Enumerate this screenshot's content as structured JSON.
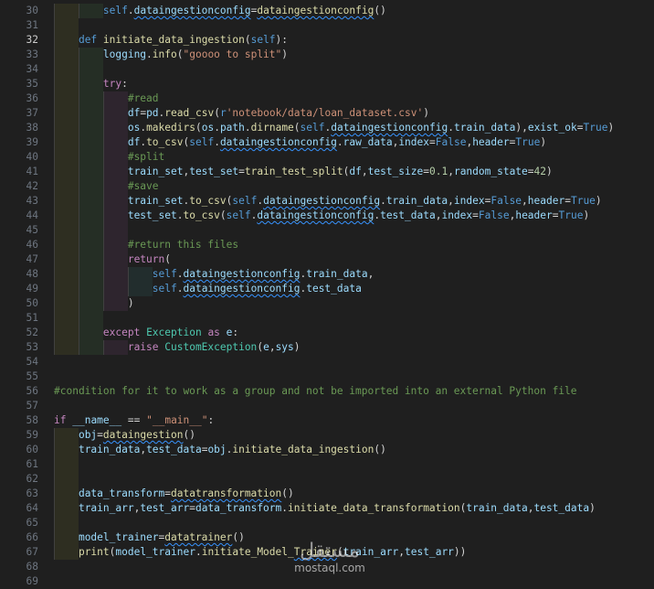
{
  "editor": {
    "lines": [
      {
        "n": "30",
        "text": "        self.dataingestionconfig=dataingestionconfig()"
      },
      {
        "n": "31",
        "text": ""
      },
      {
        "n": "32",
        "text": "    def initiate_data_ingestion(self):"
      },
      {
        "n": "33",
        "text": "        logging.info(\"goooo to split\")"
      },
      {
        "n": "34",
        "text": ""
      },
      {
        "n": "35",
        "text": "        try:"
      },
      {
        "n": "36",
        "text": "            #read"
      },
      {
        "n": "37",
        "text": "            df=pd.read_csv(r'notebook/data/loan_dataset.csv')"
      },
      {
        "n": "38",
        "text": "            os.makedirs(os.path.dirname(self.dataingestionconfig.train_data),exist_ok=True)"
      },
      {
        "n": "39",
        "text": "            df.to_csv(self.dataingestionconfig.raw_data,index=False,header=True)"
      },
      {
        "n": "40",
        "text": "            #split"
      },
      {
        "n": "41",
        "text": "            train_set,test_set=train_test_split(df,test_size=0.1,random_state=42)"
      },
      {
        "n": "42",
        "text": "            #save"
      },
      {
        "n": "43",
        "text": "            train_set.to_csv(self.dataingestionconfig.train_data,index=False,header=True)"
      },
      {
        "n": "44",
        "text": "            test_set.to_csv(self.dataingestionconfig.test_data,index=False,header=True)"
      },
      {
        "n": "45",
        "text": ""
      },
      {
        "n": "46",
        "text": "            #return this files"
      },
      {
        "n": "47",
        "text": "            return("
      },
      {
        "n": "48",
        "text": "                self.dataingestionconfig.train_data,"
      },
      {
        "n": "49",
        "text": "                self.dataingestionconfig.test_data"
      },
      {
        "n": "50",
        "text": "            )"
      },
      {
        "n": "51",
        "text": ""
      },
      {
        "n": "52",
        "text": "        except Exception as e:"
      },
      {
        "n": "53",
        "text": "            raise CustomException(e,sys)"
      },
      {
        "n": "54",
        "text": ""
      },
      {
        "n": "55",
        "text": ""
      },
      {
        "n": "56",
        "text": "#condition for it to work as a group and not be imported into an external Python file"
      },
      {
        "n": "57",
        "text": ""
      },
      {
        "n": "58",
        "text": "if __name__ == \"__main__\":"
      },
      {
        "n": "59",
        "text": "    obj=dataingestion()"
      },
      {
        "n": "60",
        "text": "    train_data,test_data=obj.initiate_data_ingestion()"
      },
      {
        "n": "61",
        "text": ""
      },
      {
        "n": "62",
        "text": ""
      },
      {
        "n": "63",
        "text": "    data_transform=datatransformation()"
      },
      {
        "n": "64",
        "text": "    train_arr,test_arr=data_transform.initiate_data_transformation(train_data,test_data)"
      },
      {
        "n": "65",
        "text": ""
      },
      {
        "n": "66",
        "text": "    model_trainer=datatrainer()"
      },
      {
        "n": "67",
        "text": "    print(model_trainer.initiate_Model_Trainer(train_arr,test_arr))"
      },
      {
        "n": "68",
        "text": ""
      },
      {
        "n": "69",
        "text": ""
      }
    ],
    "current_line": "32"
  },
  "watermark": {
    "arabic": "مستقل",
    "latin": "mostaql.com"
  },
  "colors": {
    "background": "#1f1f1f",
    "keyword": "#569cd6",
    "control": "#c586c0",
    "function": "#dcdcaa",
    "string": "#ce9178",
    "comment": "#6a9955",
    "number": "#b5cea8",
    "variable": "#9cdcfe",
    "class": "#4ec9b0"
  }
}
